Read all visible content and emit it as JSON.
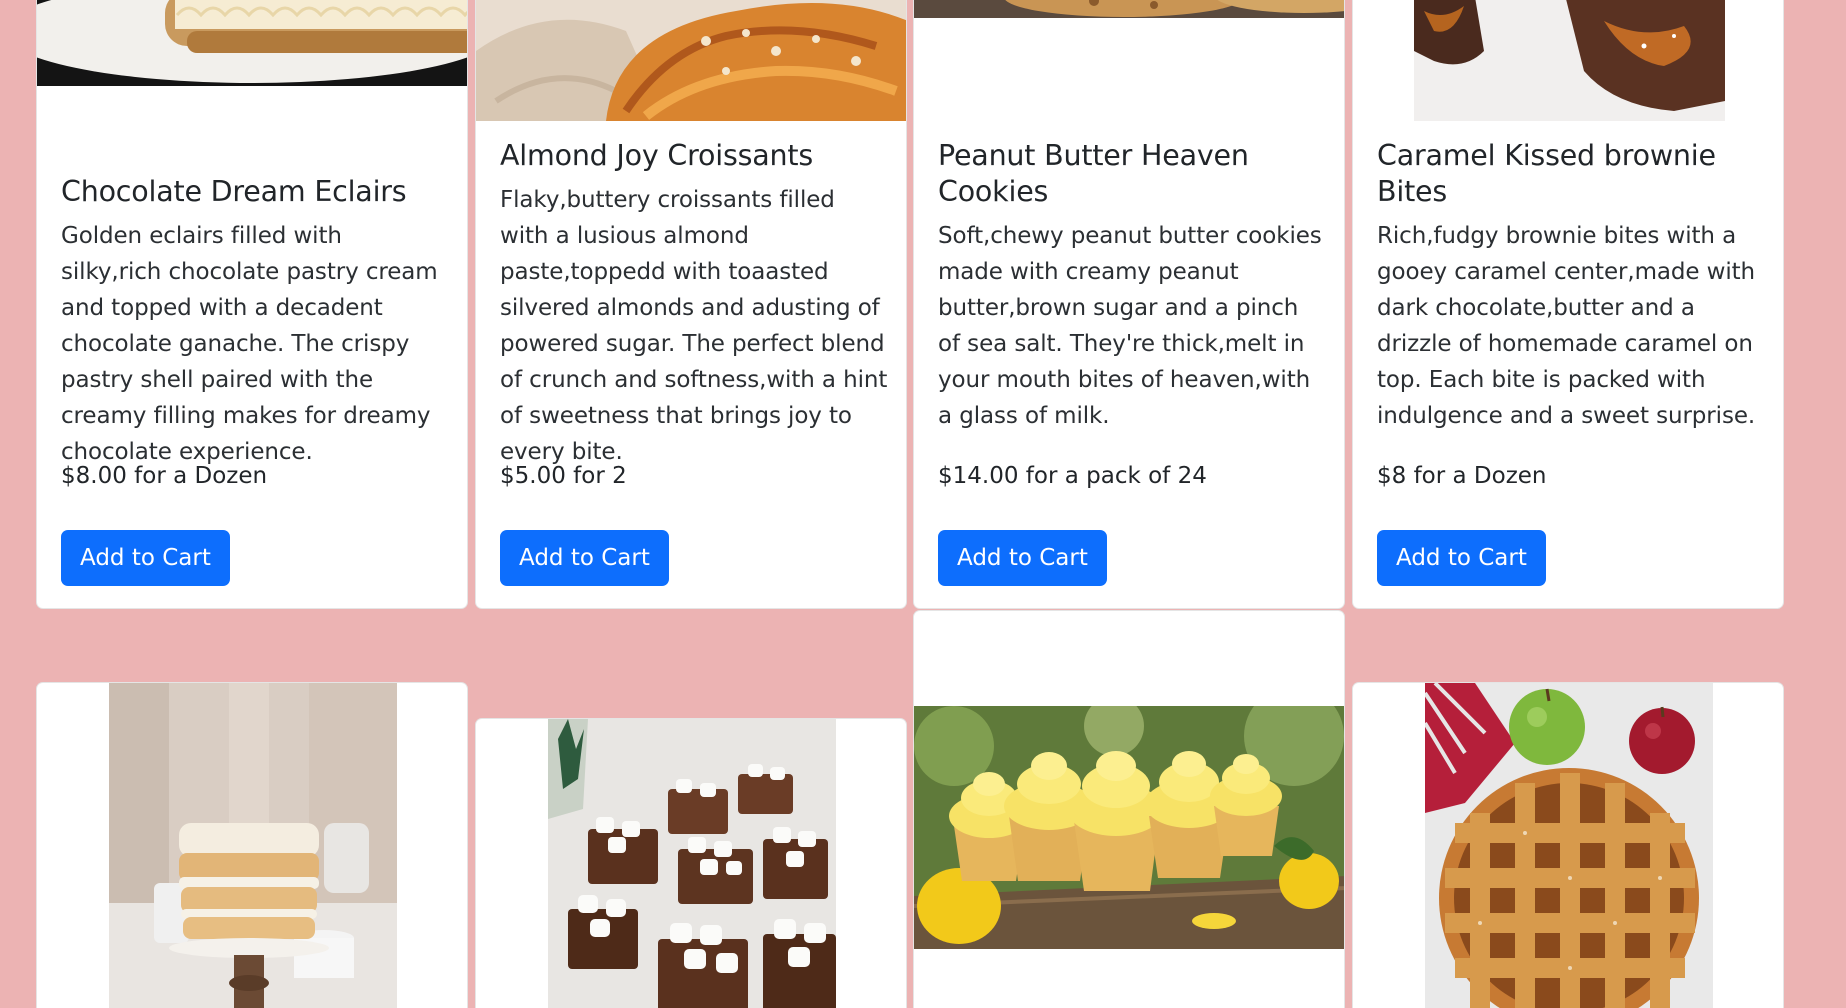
{
  "products_top": [
    {
      "title": "Chocolate Dream Eclairs",
      "description": "Golden eclairs filled with silky,rich chocolate pastry cream and topped with a decadent chocolate ganache. The crispy pastry shell paired with the creamy filling makes for dreamy chocolate experience.",
      "price": "$8.00 for a Dozen",
      "button": "Add to Cart",
      "image": "eclair-photo"
    },
    {
      "title": "Almond Joy Croissants",
      "description": "Flaky,buttery croissants filled with a lusious almond paste,toppedd with toaasted silvered almonds and adusting of powered sugar. The perfect blend of crunch and softness,with a hint of sweetness that brings joy to every bite.",
      "price": "$5.00 for 2",
      "button": "Add to Cart",
      "image": "croissant-photo"
    },
    {
      "title": "Peanut Butter Heaven Cookies",
      "description": "Soft,chewy peanut butter cookies made with creamy peanut butter,brown sugar and a pinch of sea salt. They're thick,melt in your mouth bites of heaven,with a glass of milk.",
      "price": "$14.00 for a pack of 24",
      "button": "Add to Cart",
      "image": "cookie-photo"
    },
    {
      "title": "Caramel Kissed brownie Bites",
      "description": "Rich,fudgy brownie bites with a gooey caramel center,made with dark chocolate,butter and a drizzle of homemade caramel on top. Each bite is packed with indulgence and a sweet surprise.",
      "price": "$8 for a Dozen",
      "button": "Add to Cart",
      "image": "brownie-photo"
    }
  ],
  "products_bottom": [
    {
      "image": "layer-cake-photo"
    },
    {
      "image": "marshmallow-fudge-photo"
    },
    {
      "image": "lemon-cupcakes-photo"
    },
    {
      "image": "apple-pie-photo"
    }
  ],
  "colors": {
    "page_background": "#ecb3b3",
    "card_background": "#ffffff",
    "button": "#0d6efd",
    "button_text": "#ffffff"
  }
}
